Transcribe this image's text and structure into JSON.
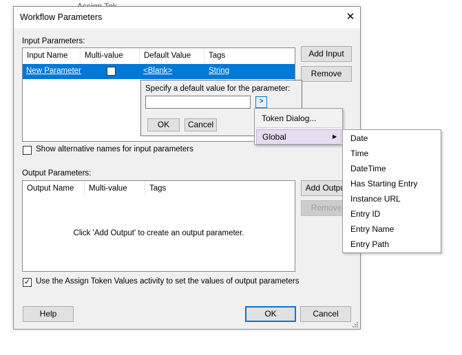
{
  "background": {
    "partial_text": "Assign Tok"
  },
  "dialog": {
    "title": "Workflow Parameters",
    "close_glyph": "✕",
    "input_section_label": "Input Parameters:",
    "input_columns": [
      "Input Name",
      "Multi-value",
      "Default Value",
      "Tags"
    ],
    "input_rows": [
      {
        "name": "New Parameter",
        "multi_value": false,
        "default_value": "<Blank>",
        "tags": "String"
      }
    ],
    "add_input_label": "Add Input",
    "remove_input_label": "Remove",
    "show_alt_names_label": "Show alternative names for input parameters",
    "show_alt_names_checked": false,
    "output_section_label": "Output Parameters:",
    "output_columns": [
      "Output Name",
      "Multi-value",
      "Tags"
    ],
    "output_empty_message": "Click 'Add Output' to create an output parameter.",
    "add_output_label": "Add Output",
    "remove_output_label": "Remove",
    "assign_token_label": "Use the Assign Token Values activity to set the values of output parameters",
    "assign_token_checked": true,
    "help_label": "Help",
    "ok_label": "OK",
    "cancel_label": "Cancel"
  },
  "default_value_popup": {
    "prompt": "Specify a default value for the parameter:",
    "value": "",
    "arrow_label": ">",
    "ok_label": "OK",
    "cancel_label": "Cancel"
  },
  "token_menu": {
    "items": [
      {
        "label": "Token Dialog...",
        "has_submenu": false
      },
      {
        "label": "Global",
        "has_submenu": true,
        "arrow": "▶"
      }
    ]
  },
  "global_submenu": {
    "items": [
      "Date",
      "Time",
      "DateTime",
      "Has Starting Entry",
      "Instance URL",
      "Entry ID",
      "Entry Name",
      "Entry Path"
    ]
  },
  "colors": {
    "selection": "#0078d7",
    "menu_highlight": "#e6ddf0",
    "dialog_bg": "#f0f0f0"
  }
}
